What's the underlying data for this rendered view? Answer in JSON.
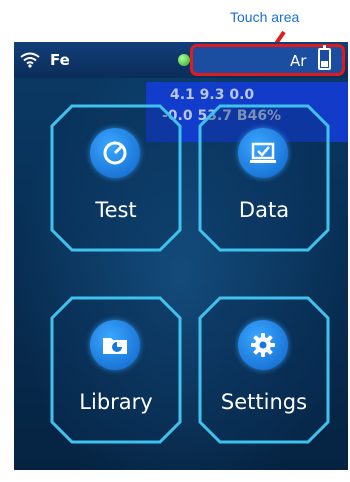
{
  "annotation": {
    "touch_area_label": "Touch area"
  },
  "status_bar": {
    "element": "Fe",
    "gas": "Ar"
  },
  "readout": {
    "line1": "4.1 9.3 0.0",
    "line2": "-0.0 53.7 B46%"
  },
  "menu": {
    "test": {
      "label": "Test",
      "icon": "gauge-icon"
    },
    "data": {
      "label": "Data",
      "icon": "laptop-check-icon"
    },
    "library": {
      "label": "Library",
      "icon": "folder-pie-icon"
    },
    "settings": {
      "label": "Settings",
      "icon": "gear-icon"
    }
  },
  "colors": {
    "accent": "#1a8cff",
    "frame": "#3fc3ee",
    "annotation": "#e11b1b",
    "background": "#082a4e"
  }
}
